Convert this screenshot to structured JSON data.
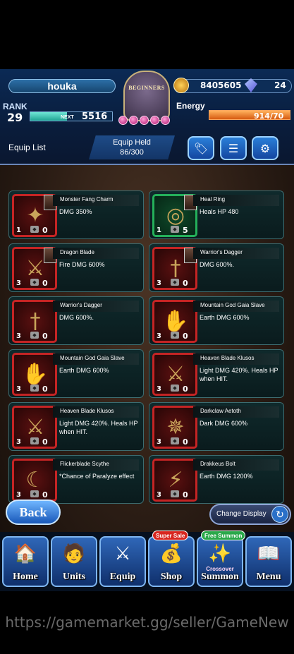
{
  "player": {
    "name": "houka",
    "rank_label": "RANK",
    "rank": "29",
    "next_label": "NEXT",
    "next_value": "5516",
    "exp_fraction": 0.45
  },
  "emblem": "BEGINNERS",
  "currency": {
    "coins": "8405605",
    "crystals": "24"
  },
  "energy": {
    "label": "Energy",
    "value": "914/70",
    "fraction": 1.0
  },
  "equip": {
    "list_label": "Equip List",
    "held_label": "Equip Held",
    "held_value": "86/300"
  },
  "items": [
    {
      "name": "Monster Fang Charm",
      "effect": "DMG 350%",
      "level": "1",
      "count": "0",
      "frame": "red",
      "icon": "charm-icon"
    },
    {
      "name": "Heal Ring",
      "effect": "Heals HP 480",
      "level": "1",
      "count": "5",
      "frame": "green",
      "icon": "ring-icon"
    },
    {
      "name": "Dragon Blade",
      "effect": "Fire DMG 600%",
      "level": "3",
      "count": "0",
      "frame": "red",
      "icon": "blade-icon"
    },
    {
      "name": "Warrior's Dagger",
      "effect": "DMG 600%.",
      "level": "3",
      "count": "0",
      "frame": "red",
      "icon": "dagger-icon"
    },
    {
      "name": "Warrior's Dagger",
      "effect": "DMG 600%.",
      "level": "3",
      "count": "0",
      "frame": "red",
      "icon": "dagger-icon"
    },
    {
      "name": "Mountain God Gaia Slave",
      "effect": "Earth DMG 600%",
      "level": "3",
      "count": "0",
      "frame": "red",
      "icon": "gauntlet-icon"
    },
    {
      "name": "Mountain God Gaia Slave",
      "effect": "Earth DMG 600%",
      "level": "3",
      "count": "0",
      "frame": "red",
      "icon": "gauntlet-icon"
    },
    {
      "name": "Heaven Blade Klusos",
      "effect": "Light DMG 420%. Heals HP when HIT.",
      "level": "3",
      "count": "0",
      "frame": "red",
      "icon": "sword-icon"
    },
    {
      "name": "Heaven Blade Klusos",
      "effect": "Light DMG 420%. Heals HP when HIT.",
      "level": "3",
      "count": "0",
      "frame": "red",
      "icon": "sword-icon"
    },
    {
      "name": "Darkclaw Aetoth",
      "effect": "Dark DMG 600%",
      "level": "3",
      "count": "0",
      "frame": "red",
      "icon": "claw-icon"
    },
    {
      "name": "Flickerblade Scythe",
      "effect": "*Chance of Paralyze effect",
      "level": "3",
      "count": "0",
      "frame": "red",
      "icon": "scythe-icon"
    },
    {
      "name": "Drakkeus Bolt",
      "effect": "Earth DMG 1200%",
      "level": "3",
      "count": "0",
      "frame": "red",
      "icon": "bolt-icon"
    }
  ],
  "buttons": {
    "back": "Back",
    "change_display": "Change Display"
  },
  "nav": [
    {
      "label": "Home",
      "icon": "house-icon"
    },
    {
      "label": "Units",
      "icon": "units-icon"
    },
    {
      "label": "Equip",
      "icon": "sword-shield-icon"
    },
    {
      "label": "Shop",
      "icon": "treasure-icon",
      "tag": "Super Sale"
    },
    {
      "label": "Summon",
      "icon": "summon-icon",
      "tag": "Free Summon",
      "sub": "Crossover"
    },
    {
      "label": "Menu",
      "icon": "book-icon"
    }
  ],
  "watermark": "https://gamemarket.gg/seller/GameNew"
}
